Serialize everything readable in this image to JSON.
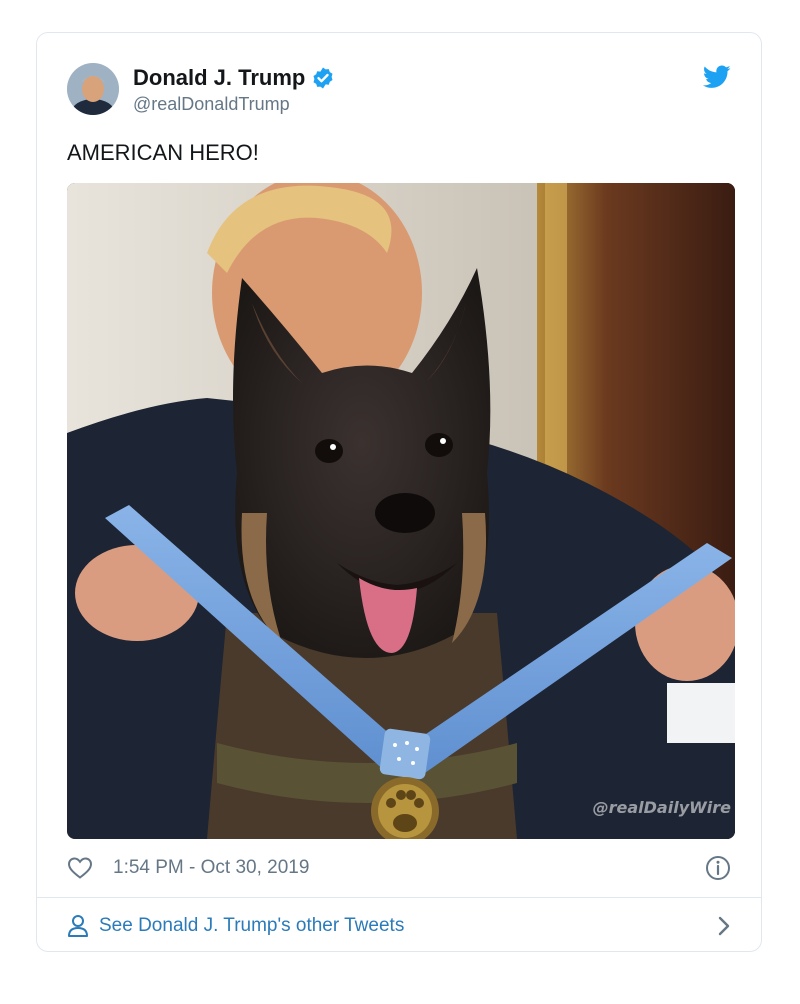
{
  "tweet": {
    "author_name": "Donald J. Trump",
    "author_handle": "@realDonaldTrump",
    "text": "AMERICAN HERO!",
    "timestamp": "1:54 PM - Oct 30, 2019",
    "media_watermark": "@realDailyWire"
  },
  "footer": {
    "other_tweets_label": "See Donald J. Trump's other Tweets"
  },
  "icons": {
    "avatar": "author-avatar",
    "verified": "verified-badge-icon",
    "brand": "twitter-bird-icon",
    "like": "heart-icon",
    "info": "info-icon",
    "person": "person-icon",
    "chevron": "chevron-right-icon"
  },
  "colors": {
    "brand_blue": "#1da1f2",
    "verified_blue": "#1da1f2",
    "link_blue": "#2b7bb9",
    "secondary_text": "#657786",
    "primary_text": "#14171a",
    "border": "#e1e8ed"
  }
}
